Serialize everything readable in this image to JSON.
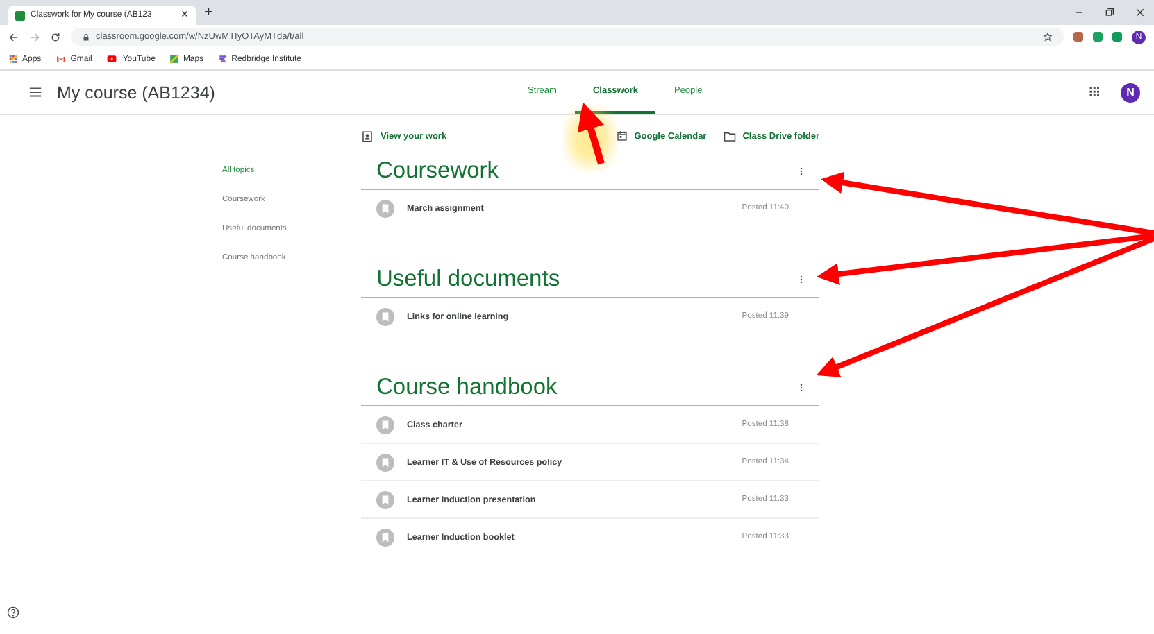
{
  "browser": {
    "tab_title": "Classwork for My course (AB123",
    "new_tab": "+",
    "url": "classroom.google.com/w/NzUwMTIyOTAyMTda/t/all",
    "profile": "N",
    "bookmarks": [
      {
        "label": "Apps",
        "kind": "apps"
      },
      {
        "label": "Gmail",
        "kind": "gmail"
      },
      {
        "label": "YouTube",
        "kind": "youtube"
      },
      {
        "label": "Maps",
        "kind": "maps"
      },
      {
        "label": "Redbridge Institute",
        "kind": "site"
      }
    ]
  },
  "header": {
    "title": "My course (AB1234)",
    "avatar": "N",
    "tabs": [
      {
        "label": "Stream",
        "selected": false
      },
      {
        "label": "Classwork",
        "selected": true
      },
      {
        "label": "People",
        "selected": false
      }
    ]
  },
  "toolbar": {
    "view_work": "View your work",
    "calendar": "Google Calendar",
    "drive": "Class Drive folder"
  },
  "topics": [
    {
      "label": "All topics",
      "selected": true
    },
    {
      "label": "Coursework",
      "selected": false
    },
    {
      "label": "Useful documents",
      "selected": false
    },
    {
      "label": "Course handbook",
      "selected": false
    }
  ],
  "sections": [
    {
      "title": "Coursework",
      "items": [
        {
          "title": "March assignment",
          "posted": "Posted 11:40"
        }
      ]
    },
    {
      "title": "Useful documents",
      "items": [
        {
          "title": "Links for online learning",
          "posted": "Posted 11:39"
        }
      ]
    },
    {
      "title": "Course handbook",
      "items": [
        {
          "title": "Class charter",
          "posted": "Posted 11:38"
        },
        {
          "title": "Learner IT & Use of Resources policy",
          "posted": "Posted 11:34"
        },
        {
          "title": "Learner Induction presentation",
          "posted": "Posted 11:33"
        },
        {
          "title": "Learner Induction booklet",
          "posted": "Posted 11:33"
        }
      ]
    }
  ]
}
